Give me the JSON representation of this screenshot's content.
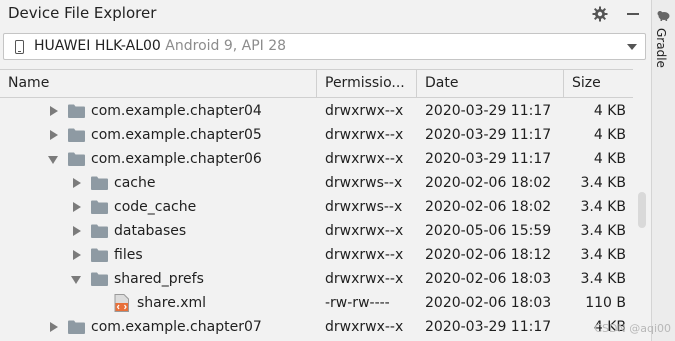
{
  "window": {
    "title": "Device File Explorer",
    "side_tab": "Gradle"
  },
  "device": {
    "name": "HUAWEI HLK-AL00",
    "meta": "Android 9, API 28"
  },
  "columns": {
    "name": "Name",
    "permissions": "Permissio...",
    "date": "Date",
    "size": "Size"
  },
  "rows": [
    {
      "name": "com.example.chapter04",
      "permissions": "drwxrwx--x",
      "date": "2020-03-29 11:17",
      "size": "4 KB",
      "depth": 0,
      "type": "folder",
      "state": "collapsed"
    },
    {
      "name": "com.example.chapter05",
      "permissions": "drwxrwx--x",
      "date": "2020-03-29 11:17",
      "size": "4 KB",
      "depth": 0,
      "type": "folder",
      "state": "collapsed"
    },
    {
      "name": "com.example.chapter06",
      "permissions": "drwxrwx--x",
      "date": "2020-03-29 11:17",
      "size": "4 KB",
      "depth": 0,
      "type": "folder",
      "state": "expanded"
    },
    {
      "name": "cache",
      "permissions": "drwxrws--x",
      "date": "2020-02-06 18:02",
      "size": "3.4 KB",
      "depth": 1,
      "type": "folder",
      "state": "collapsed"
    },
    {
      "name": "code_cache",
      "permissions": "drwxrws--x",
      "date": "2020-02-06 18:02",
      "size": "3.4 KB",
      "depth": 1,
      "type": "folder",
      "state": "collapsed"
    },
    {
      "name": "databases",
      "permissions": "drwxrwx--x",
      "date": "2020-05-06 15:59",
      "size": "3.4 KB",
      "depth": 1,
      "type": "folder",
      "state": "collapsed"
    },
    {
      "name": "files",
      "permissions": "drwxrwx--x",
      "date": "2020-02-06 18:12",
      "size": "3.4 KB",
      "depth": 1,
      "type": "folder",
      "state": "collapsed"
    },
    {
      "name": "shared_prefs",
      "permissions": "drwxrwx--x",
      "date": "2020-02-06 18:03",
      "size": "3.4 KB",
      "depth": 1,
      "type": "folder",
      "state": "expanded"
    },
    {
      "name": "share.xml",
      "permissions": "-rw-rw----",
      "date": "2020-02-06 18:03",
      "size": "110 B",
      "depth": 2,
      "type": "xml-file",
      "state": "none"
    },
    {
      "name": "com.example.chapter07",
      "permissions": "drwxrwx--x",
      "date": "2020-03-29 11:17",
      "size": "4 KB",
      "depth": 0,
      "type": "folder",
      "state": "collapsed"
    }
  ],
  "watermark": "CSDN @aqi00",
  "icons": {
    "settings": "gear-icon",
    "hide": "minimize-icon",
    "device": "phone-icon",
    "gradle": "elephant-icon"
  },
  "colors": {
    "folder": "#8e9aa3",
    "xml_accent": "#e8703a"
  }
}
